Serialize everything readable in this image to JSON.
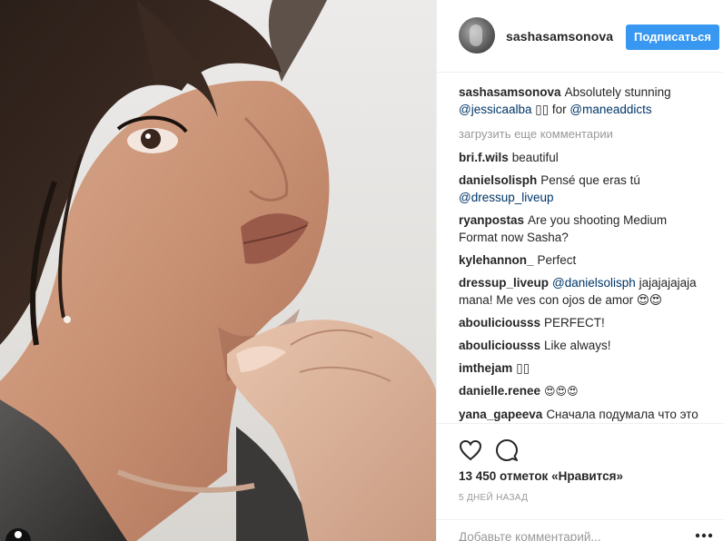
{
  "header": {
    "username": "sashasamsonova",
    "follow_label": "Подписаться"
  },
  "caption": {
    "user": "sashasamsonova",
    "text": "Absolutely stunning",
    "mention1": "@jessicaalba",
    "emoji": "▯▯",
    "word": "for",
    "mention2": "@maneaddicts"
  },
  "load_more": "загрузить еще комментарии",
  "comments": [
    {
      "user": "bri.f.wils",
      "text": "beautiful"
    },
    {
      "user": "danielsolisph",
      "text": "Pensé que eras tú",
      "mention": "@dressup_liveup"
    },
    {
      "user": "ryanpostas",
      "text": "Are you shooting Medium Format now Sasha?"
    },
    {
      "user": "kylehannon_",
      "text": "Perfect"
    },
    {
      "user": "dressup_liveup",
      "mention": "@danielsolisph",
      "text": "jajajajajaja mana! Me ves con ojos de amor 😍😍"
    },
    {
      "user": "abouliciousss",
      "text": "PERFECT!"
    },
    {
      "user": "abouliciousss",
      "text": "Like always!"
    },
    {
      "user": "imthejam",
      "text": "▯▯"
    },
    {
      "user": "danielle.renee",
      "text": "😍😍😍"
    },
    {
      "user": "yana_gapeeva",
      "text": "Сначала подумала что это Серябкина"
    }
  ],
  "likes": "13 450 отметок «Нравится»",
  "time": "5 ДНЕЙ НАЗАД",
  "add_comment_placeholder": "Добавьте комментарий...",
  "icons": {
    "heart": "heart-icon",
    "comment": "comment-icon",
    "more": "more-options-icon"
  }
}
